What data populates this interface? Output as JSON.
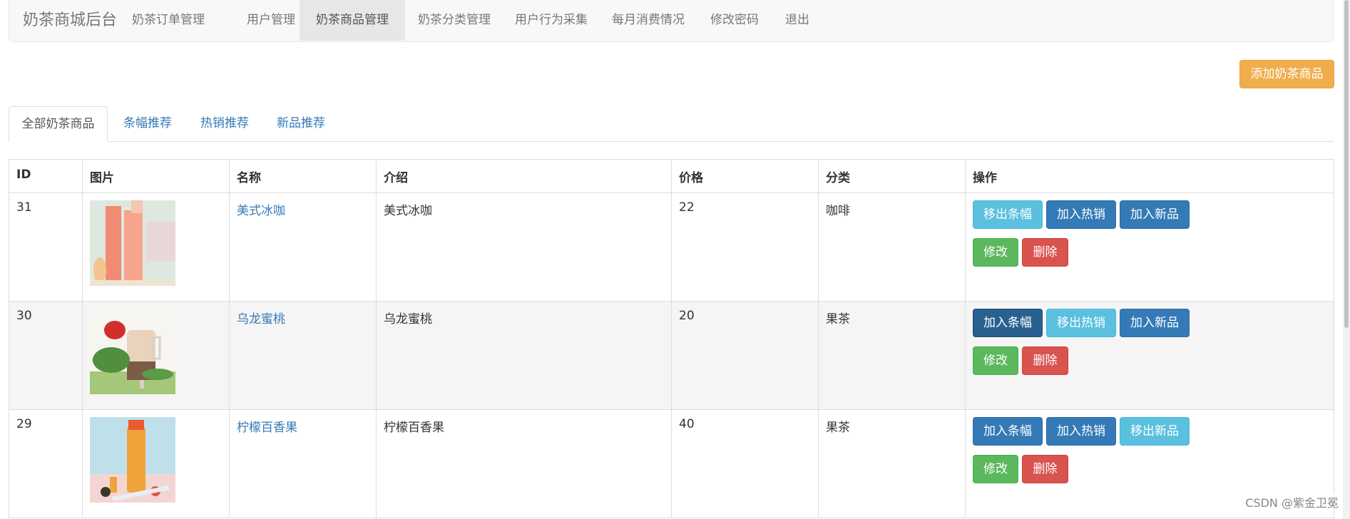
{
  "navbar": {
    "brand": "奶茶商城后台",
    "items": [
      {
        "label": "奶茶订单管理"
      },
      {
        "label": "用户管理"
      },
      {
        "label": "奶茶商品管理",
        "active": true
      },
      {
        "label": "奶茶分类管理"
      },
      {
        "label": "用户行为采集"
      },
      {
        "label": "每月消费情况"
      },
      {
        "label": "修改密码"
      },
      {
        "label": "退出"
      }
    ]
  },
  "add_button": "添加奶茶商品",
  "tabs": [
    {
      "label": "全部奶茶商品",
      "active": true
    },
    {
      "label": "条幅推荐"
    },
    {
      "label": "热销推荐"
    },
    {
      "label": "新品推荐"
    }
  ],
  "table": {
    "headers": [
      "ID",
      "图片",
      "名称",
      "介绍",
      "价格",
      "分类",
      "操作"
    ],
    "rows": [
      {
        "id": "31",
        "name": "美式冰咖",
        "intro": "美式冰咖",
        "price": "22",
        "category": "咖啡",
        "banner_btn": "移出条幅",
        "hot_btn": "加入热销",
        "new_btn": "加入新品",
        "edit_btn": "修改",
        "delete_btn": "删除"
      },
      {
        "id": "30",
        "name": "乌龙蜜桃",
        "intro": "乌龙蜜桃",
        "price": "20",
        "category": "果茶",
        "banner_btn": "加入条幅",
        "hot_btn": "移出热销",
        "new_btn": "加入新品",
        "edit_btn": "修改",
        "delete_btn": "删除"
      },
      {
        "id": "29",
        "name": "柠檬百香果",
        "intro": "柠檬百香果",
        "price": "40",
        "category": "果茶",
        "banner_btn": "加入条幅",
        "hot_btn": "加入热销",
        "new_btn": "移出新品",
        "edit_btn": "修改",
        "delete_btn": "删除"
      }
    ]
  },
  "watermark": "CSDN @紫金卫冕",
  "colors": {
    "primary": "#337ab7",
    "info": "#5bc0de",
    "success": "#5cb85c",
    "danger": "#d9534f",
    "warning": "#f0ad4e"
  }
}
